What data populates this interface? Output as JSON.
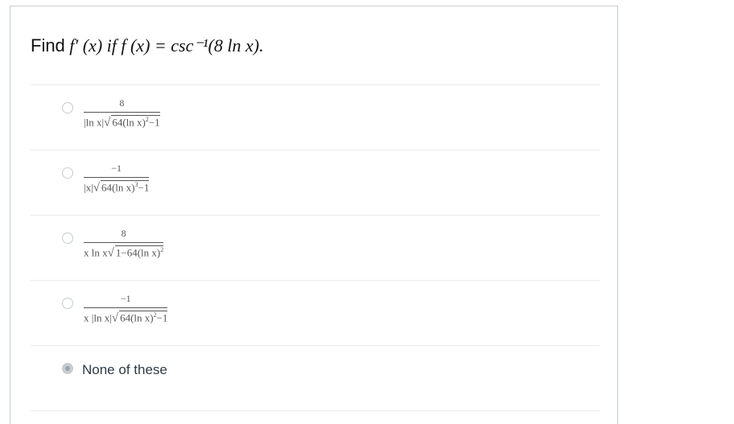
{
  "question": {
    "lead": "Find",
    "expression": "f′ (x) if f (x) = csc⁻¹(8 ln x)."
  },
  "answers": [
    {
      "numerator": "8",
      "den_prefix": "|ln x|",
      "radicand": "64(ln x)",
      "exponent": "2",
      "radicand_tail": "−1",
      "selected": false
    },
    {
      "numerator": "−1",
      "den_prefix": "|x|",
      "radicand": "64(ln x)",
      "exponent": "3",
      "radicand_tail": "−1",
      "selected": false
    },
    {
      "numerator": "8",
      "den_prefix": "x  ln x",
      "radicand": "1−64(ln x)",
      "exponent": "2",
      "radicand_tail": "",
      "selected": false
    },
    {
      "numerator": "−1",
      "den_prefix": "x  |ln x|",
      "radicand": "64(ln x)",
      "exponent": "2",
      "radicand_tail": "−1",
      "selected": false
    },
    {
      "label": "None of these",
      "selected": true
    }
  ]
}
